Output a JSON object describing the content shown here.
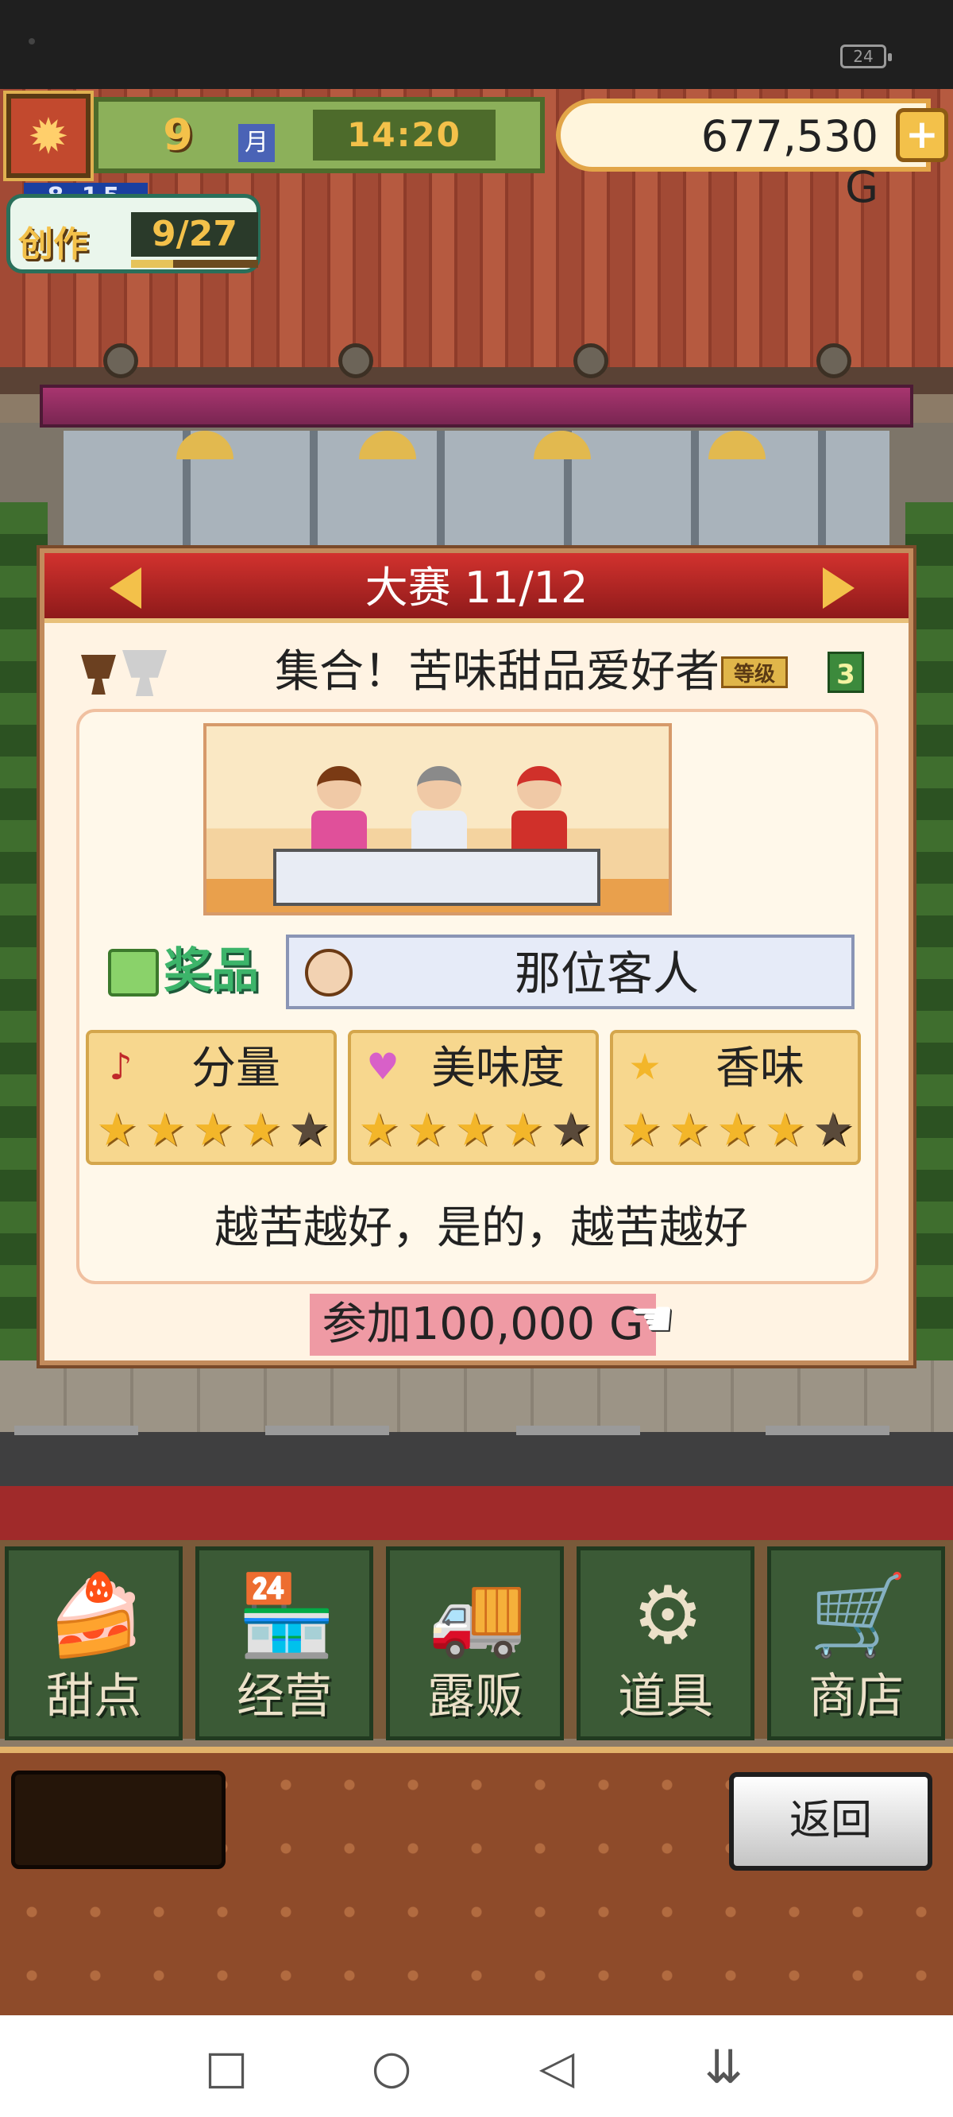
{
  "status_bar": {
    "battery": "24"
  },
  "hud": {
    "month_number": "9",
    "month_unit": "月",
    "time": "14:20",
    "money": "677,530 G",
    "add_money_symbol": "+",
    "create_label": "创作",
    "create_sub_label": "8 15",
    "create_progress": "9/27",
    "create_progress_fraction": 0.33
  },
  "dialog": {
    "title": "大赛 11/12",
    "contest_name": "集合！苦味甜品爱好者",
    "rank_badge": "等级",
    "rank_value": "3",
    "prize_label": "奖品",
    "prize_value": "那位客人",
    "stats": [
      {
        "label": "分量",
        "icon": "music-note-icon",
        "stars": 4,
        "max_stars": 5
      },
      {
        "label": "美味度",
        "icon": "heart-icon",
        "stars": 4,
        "max_stars": 5
      },
      {
        "label": "香味",
        "icon": "star-icon",
        "stars": 4,
        "max_stars": 5
      }
    ],
    "description": "越苦越好，是的，越苦越好",
    "join_label": "参加100,000 G"
  },
  "nav": {
    "items": [
      {
        "label": "甜点",
        "icon": "cake-icon"
      },
      {
        "label": "经营",
        "icon": "shop-icon"
      },
      {
        "label": "露贩",
        "icon": "food-truck-icon"
      },
      {
        "label": "道具",
        "icon": "items-icon"
      },
      {
        "label": "商店",
        "icon": "cart-icon"
      }
    ],
    "back_label": "返回"
  },
  "colors": {
    "header_red": "#c0282a",
    "star_on": "#f3b62a",
    "join_pink": "#ef9aa4",
    "nav_green": "#3b5a36"
  }
}
